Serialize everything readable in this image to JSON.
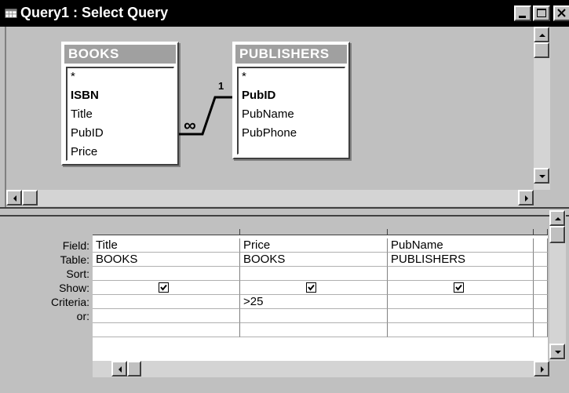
{
  "window": {
    "title": "Query1 : Select Query"
  },
  "tables": [
    {
      "name": "BOOKS",
      "fields": [
        "*",
        "ISBN",
        "Title",
        "PubID",
        "Price"
      ],
      "key": "ISBN"
    },
    {
      "name": "PUBLISHERS",
      "fields": [
        "*",
        "PubID",
        "PubName",
        "PubPhone"
      ],
      "key": "PubID"
    }
  ],
  "relationship": {
    "one_side": "1",
    "many_side": "∞"
  },
  "grid": {
    "row_labels": [
      "Field:",
      "Table:",
      "Sort:",
      "Show:",
      "Criteria:",
      "or:"
    ],
    "columns": [
      {
        "field": "Title",
        "table": "BOOKS",
        "sort": "",
        "show": true,
        "criteria": "",
        "or": ""
      },
      {
        "field": "Price",
        "table": "BOOKS",
        "sort": "",
        "show": true,
        "criteria": ">25",
        "or": ""
      },
      {
        "field": "PubName",
        "table": "PUBLISHERS",
        "sort": "",
        "show": true,
        "criteria": "",
        "or": ""
      }
    ]
  },
  "icons": [
    "query-icon",
    "minimize-icon",
    "maximize-icon",
    "close-icon",
    "arrow-up-icon",
    "arrow-down-icon",
    "arrow-left-icon",
    "arrow-right-icon",
    "checkmark-icon"
  ]
}
